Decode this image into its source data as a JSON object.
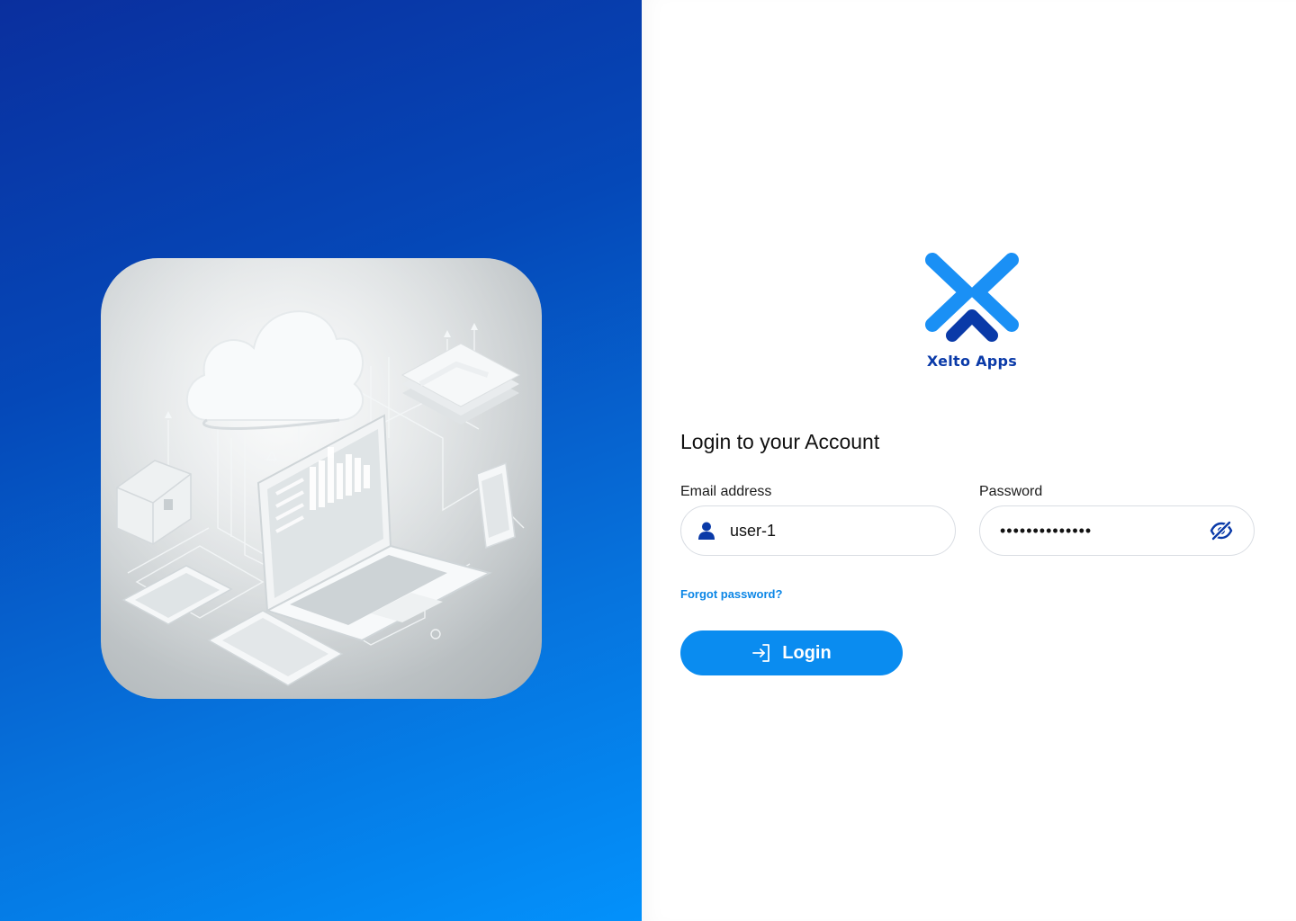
{
  "brand": {
    "name": "Xelto Apps",
    "colors": {
      "primary": "#0a8cf0",
      "dark": "#0a3aa8",
      "light": "#1a90f5"
    }
  },
  "illustration": {
    "icon": "cloud-devices-illustration"
  },
  "form": {
    "title": "Login to your Account",
    "email": {
      "label": "Email address",
      "value": "user-1",
      "icon": "user-icon"
    },
    "password": {
      "label": "Password",
      "value": "••••••••••••••",
      "toggle_icon": "eye-slash-icon"
    },
    "forgot_label": "Forgot password?",
    "login_label": "Login",
    "login_icon": "login-arrow-icon"
  }
}
